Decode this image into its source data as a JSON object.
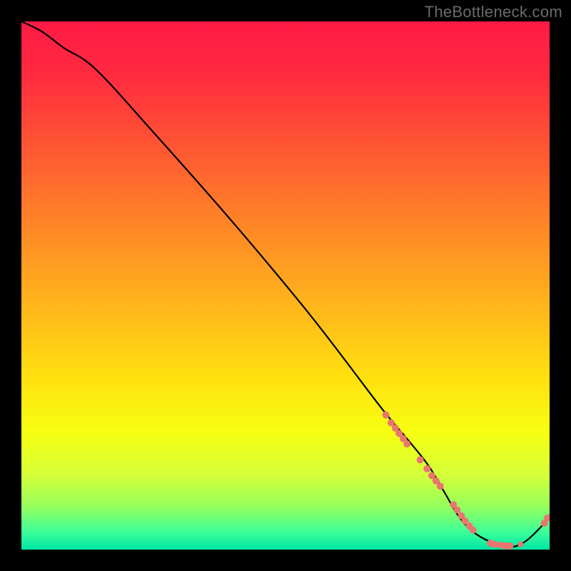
{
  "watermark": "TheBottleneck.com",
  "colors": {
    "background": "#000000",
    "gradient_stops": [
      {
        "offset": 0.0,
        "color": "#ff1a46"
      },
      {
        "offset": 0.1,
        "color": "#ff2a3f"
      },
      {
        "offset": 0.25,
        "color": "#ff5a32"
      },
      {
        "offset": 0.4,
        "color": "#ff8a26"
      },
      {
        "offset": 0.55,
        "color": "#ffb91a"
      },
      {
        "offset": 0.68,
        "color": "#ffe20f"
      },
      {
        "offset": 0.78,
        "color": "#f6ff12"
      },
      {
        "offset": 0.86,
        "color": "#d4ff3a"
      },
      {
        "offset": 0.92,
        "color": "#94ff5e"
      },
      {
        "offset": 0.965,
        "color": "#3fff98"
      },
      {
        "offset": 1.0,
        "color": "#00e6a6"
      }
    ],
    "line": "#000000",
    "marker": "#e9766e"
  },
  "chart_data": {
    "type": "line",
    "title": "",
    "xlabel": "",
    "ylabel": "",
    "xlim": [
      0,
      100
    ],
    "ylim": [
      0,
      100
    ],
    "grid": false,
    "series": [
      {
        "name": "curve",
        "x": [
          0,
          4,
          8,
          14,
          25,
          40,
          55,
          68,
          73,
          77,
          80,
          83,
          86,
          90,
          93,
          96,
          100
        ],
        "y": [
          100,
          98,
          95,
          91,
          79,
          62,
          44,
          27,
          21,
          16,
          11,
          6,
          3,
          1,
          0.5,
          2,
          6
        ]
      }
    ],
    "markers": [
      {
        "x": 69.0,
        "y": 25.5,
        "r": 5
      },
      {
        "x": 70.0,
        "y": 24.0,
        "r": 5
      },
      {
        "x": 70.8,
        "y": 23.0,
        "r": 5
      },
      {
        "x": 71.5,
        "y": 22.0,
        "r": 5
      },
      {
        "x": 72.3,
        "y": 21.0,
        "r": 5
      },
      {
        "x": 73.0,
        "y": 20.0,
        "r": 5
      },
      {
        "x": 75.5,
        "y": 17.0,
        "r": 5
      },
      {
        "x": 76.8,
        "y": 15.3,
        "r": 5
      },
      {
        "x": 77.7,
        "y": 14.0,
        "r": 5
      },
      {
        "x": 78.5,
        "y": 13.0,
        "r": 5
      },
      {
        "x": 79.3,
        "y": 12.0,
        "r": 5
      },
      {
        "x": 81.8,
        "y": 8.5,
        "r": 5
      },
      {
        "x": 82.5,
        "y": 7.5,
        "r": 5
      },
      {
        "x": 83.3,
        "y": 6.4,
        "r": 5
      },
      {
        "x": 84.0,
        "y": 5.4,
        "r": 5
      },
      {
        "x": 84.8,
        "y": 4.5,
        "r": 5
      },
      {
        "x": 85.5,
        "y": 3.7,
        "r": 5
      },
      {
        "x": 88.8,
        "y": 1.2,
        "r": 5
      },
      {
        "x": 89.6,
        "y": 1.0,
        "r": 5
      },
      {
        "x": 90.4,
        "y": 0.9,
        "r": 4
      },
      {
        "x": 91.0,
        "y": 0.8,
        "r": 5
      },
      {
        "x": 91.8,
        "y": 0.7,
        "r": 5
      },
      {
        "x": 92.5,
        "y": 0.7,
        "r": 5
      },
      {
        "x": 94.5,
        "y": 1.0,
        "r": 4
      },
      {
        "x": 99.0,
        "y": 5.0,
        "r": 5
      },
      {
        "x": 99.6,
        "y": 6.0,
        "r": 5
      }
    ]
  }
}
